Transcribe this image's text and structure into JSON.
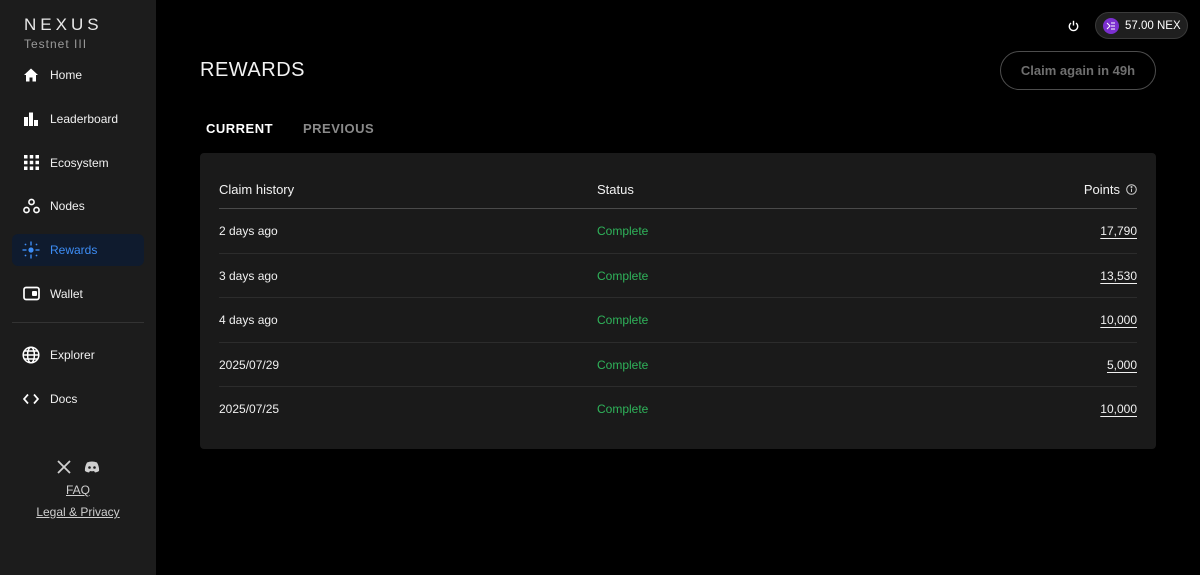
{
  "brand": {
    "name": "NEXUS",
    "subtitle": "Testnet III"
  },
  "sidebar": {
    "items": [
      {
        "label": "Home",
        "icon": "home-icon"
      },
      {
        "label": "Leaderboard",
        "icon": "bar-chart-icon"
      },
      {
        "label": "Ecosystem",
        "icon": "grid-icon"
      },
      {
        "label": "Nodes",
        "icon": "nodes-icon"
      },
      {
        "label": "Rewards",
        "icon": "sparkle-icon",
        "active": true
      },
      {
        "label": "Wallet",
        "icon": "wallet-icon"
      }
    ],
    "secondary": [
      {
        "label": "Explorer",
        "icon": "globe-icon"
      },
      {
        "label": "Docs",
        "icon": "code-icon"
      }
    ],
    "footer": {
      "faq": "FAQ",
      "legal": "Legal & Privacy"
    }
  },
  "topbar": {
    "balance": "57.00 NEX"
  },
  "main": {
    "title": "REWARDS",
    "claim_button": "Claim again in 49h",
    "tabs": {
      "current": "CURRENT",
      "previous": "PREVIOUS"
    },
    "table": {
      "headers": {
        "claim": "Claim history",
        "status": "Status",
        "points": "Points"
      },
      "rows": [
        {
          "date": "2 days ago",
          "status": "Complete",
          "points": "17,790"
        },
        {
          "date": "3 days ago",
          "status": "Complete",
          "points": "13,530"
        },
        {
          "date": "4 days ago",
          "status": "Complete",
          "points": "10,000"
        },
        {
          "date": "2025/07/29",
          "status": "Complete",
          "points": "5,000"
        },
        {
          "date": "2025/07/25",
          "status": "Complete",
          "points": "10,000"
        }
      ]
    }
  },
  "colors": {
    "accent": "#3d8df5",
    "success": "#2fb35a",
    "token": "#7b2fd0"
  }
}
